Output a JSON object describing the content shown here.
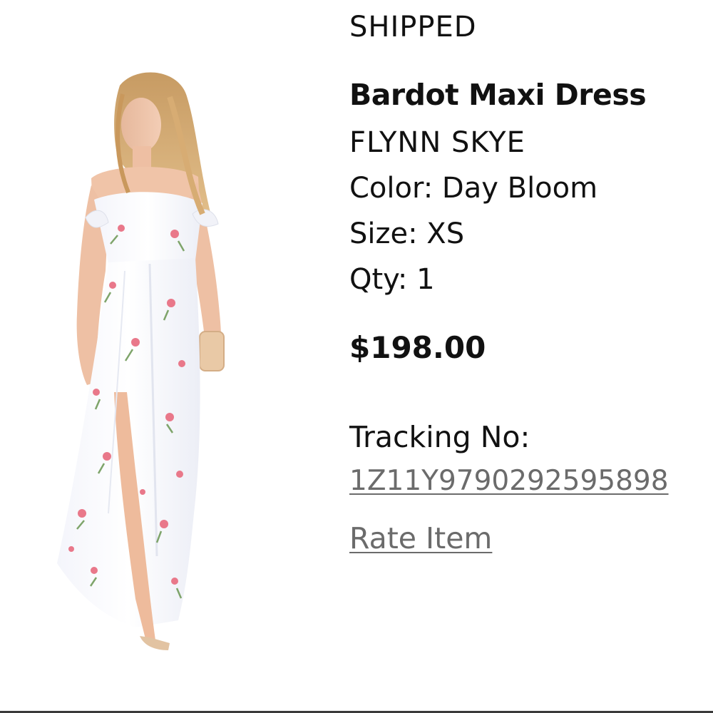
{
  "order_item": {
    "status": "SHIPPED",
    "product_name": "Bardot Maxi Dress",
    "brand": "FLYNN SKYE",
    "color": "Color: Day Bloom",
    "size": "Size: XS",
    "qty": "Qty: 1",
    "price": "$198.00",
    "tracking_label": "Tracking No:",
    "tracking_number": "1Z11Y9790292595898",
    "rate_item_label": "Rate Item"
  },
  "colors": {
    "text": "#111111",
    "link": "#6b6b6b",
    "background": "#ffffff"
  },
  "icons": {
    "product_image": "product-photo-icon"
  }
}
